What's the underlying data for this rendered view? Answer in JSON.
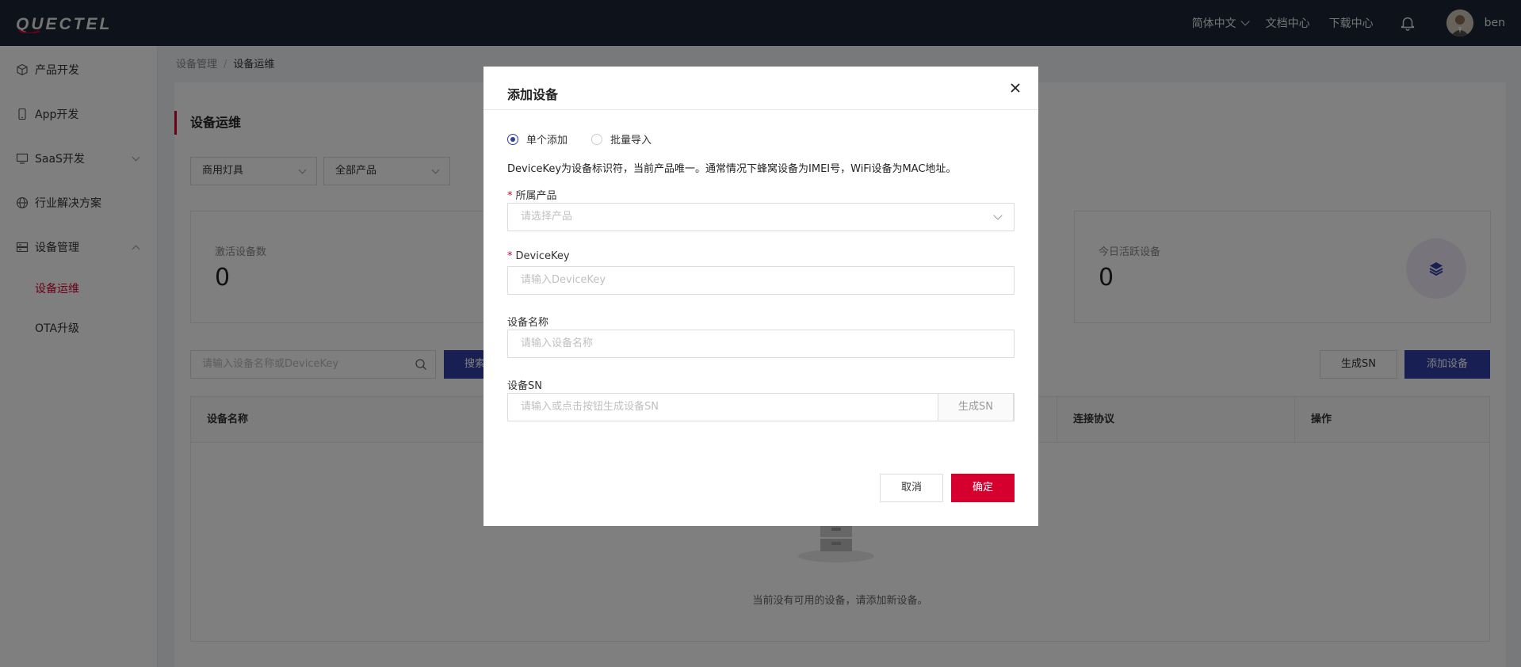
{
  "header": {
    "brand": "QUECTEL",
    "language": "简体中文",
    "docs": "文档中心",
    "downloads": "下载中心",
    "username": "ben"
  },
  "sidebar": {
    "items": [
      {
        "label": "产品开发",
        "icon": "cube-icon"
      },
      {
        "label": "App开发",
        "icon": "phone-icon"
      },
      {
        "label": "SaaS开发",
        "icon": "monitor-icon"
      },
      {
        "label": "行业解决方案",
        "icon": "globe-icon"
      },
      {
        "label": "设备管理",
        "icon": "server-icon"
      }
    ],
    "sub_items": [
      {
        "label": "设备运维",
        "active": true
      },
      {
        "label": "OTA升级",
        "active": false
      }
    ]
  },
  "breadcrumb": {
    "parent": "设备管理",
    "current": "设备运维"
  },
  "page": {
    "title": "设备运维",
    "filters": {
      "category": "商用灯具",
      "product": "全部产品"
    },
    "stats": [
      {
        "label": "激活设备数",
        "value": "0"
      },
      {
        "label": "今日活跃设备",
        "value": "0"
      }
    ],
    "search_placeholder": "请输入设备名称或DeviceKey",
    "search_button": "搜索",
    "generate_sn_button": "生成SN",
    "add_device_button": "添加设备",
    "table_headers": [
      "设备名称",
      "连接协议",
      "操作"
    ],
    "empty_text": "当前没有可用的设备，请添加新设备。"
  },
  "modal": {
    "title": "添加设备",
    "radio_single": "单个添加",
    "radio_batch": "批量导入",
    "hint": "DeviceKey为设备标识符，当前产品唯一。通常情况下蜂窝设备为IMEI号，WiFi设备为MAC地址。",
    "product_label": "所属产品",
    "product_placeholder": "请选择产品",
    "devicekey_label": "DeviceKey",
    "devicekey_placeholder": "请输入DeviceKey",
    "name_label": "设备名称",
    "name_placeholder": "请输入设备名称",
    "sn_label": "设备SN",
    "sn_placeholder": "请输入或点击按钮生成设备SN",
    "sn_button": "生成SN",
    "cancel": "取消",
    "confirm": "确定"
  },
  "colors": {
    "accent": "#d6002f",
    "primary": "#2e3fa7",
    "topbar": "#1d2535"
  }
}
